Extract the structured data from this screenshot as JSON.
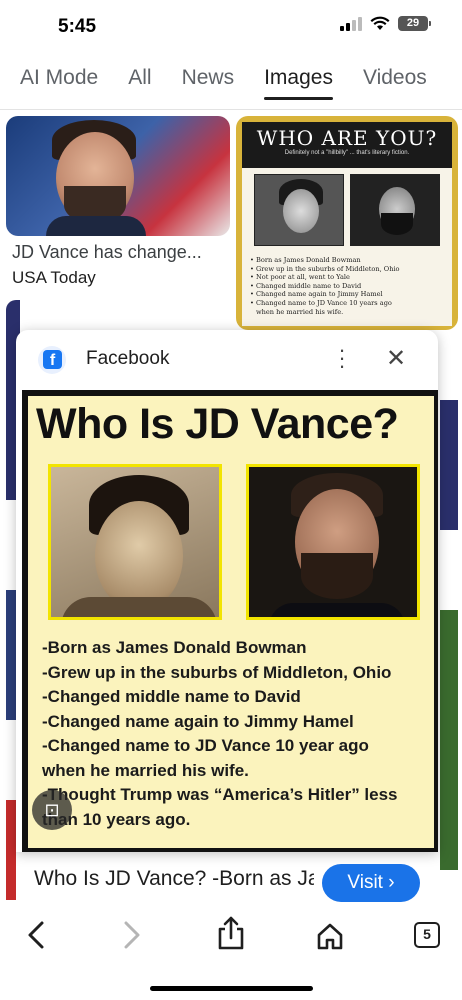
{
  "status_bar": {
    "time": "5:45",
    "battery": "29"
  },
  "tabs": [
    {
      "label": "AI Mode"
    },
    {
      "label": "All"
    },
    {
      "label": "News"
    },
    {
      "label": "Images"
    },
    {
      "label": "Videos"
    }
  ],
  "results": {
    "first": {
      "caption": "JD Vance has change...",
      "source": "USA Today"
    },
    "second": {
      "title": "WHO ARE YOU?",
      "subtitle": "Definitely not a \"hillbilly\" ... that's literary fiction.",
      "bullets": [
        "Born as James Donald Bowman",
        "Grew up in the suburbs of Middleton, Ohio",
        "Not poor at all, went to Yale",
        "Changed middle name to David",
        "Changed name again to Jimmy Hamel",
        "Changed name to JD Vance 10 years ago",
        "when he married his wife."
      ]
    }
  },
  "preview": {
    "source_name": "Facebook",
    "poster_title": "Who Is JD Vance?",
    "poster_lines": [
      "-Born as James Donald Bowman",
      "-Grew up in the suburbs of Middleton, Ohio",
      "-Changed middle name to David",
      "-Changed name again to Jimmy Hamel",
      "-Changed name to JD Vance 10 year ago",
      "when he married his wife.",
      "-Thought Trump was “America’s Hitler” less",
      "than 10 years ago."
    ],
    "card_title": "Who Is JD Vance? -Born as James Donald",
    "visit_label": "Visit ›"
  },
  "bottom_nav": {
    "tab_count": "5"
  },
  "colors": {
    "accent": "#1a73e8",
    "facebook": "#1877f2",
    "poster_bg": "#fbf3bd"
  }
}
